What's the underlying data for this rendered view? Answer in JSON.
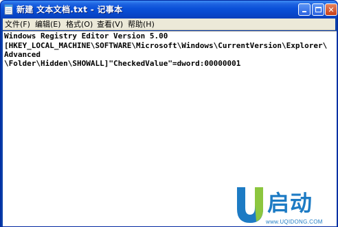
{
  "window": {
    "title": "新建 文本文档.txt - 记事本",
    "app_icon": "notepad-icon"
  },
  "menu": {
    "items": [
      {
        "label": "文件(F)"
      },
      {
        "label": "编辑(E)"
      },
      {
        "label": "格式(O)"
      },
      {
        "label": "查看(V)"
      },
      {
        "label": "帮助(H)"
      }
    ]
  },
  "document": {
    "lines": [
      "Windows Registry Editor Version 5.00",
      "[HKEY_LOCAL_MACHINE\\SOFTWARE\\Microsoft\\Windows\\CurrentVersion\\Explorer\\",
      "Advanced",
      "\\Folder\\Hidden\\SHOWALL]\"CheckedValue\"=dword:00000001"
    ]
  },
  "watermark": {
    "brand": "启动",
    "url": "www.UQIDONG.COM",
    "accent": "#1d7bc4"
  },
  "colors": {
    "titlebar": "#0a50d8",
    "menubar": "#ece9d8",
    "editor_bg": "#ffffff"
  }
}
